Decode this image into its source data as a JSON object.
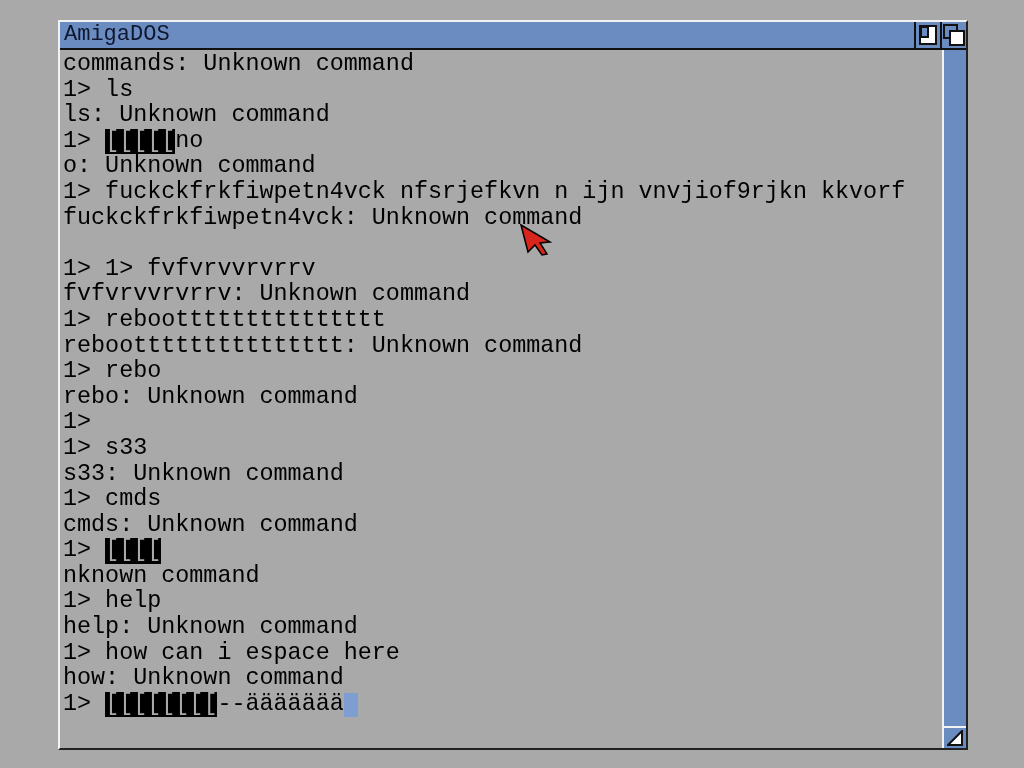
{
  "window": {
    "title": "AmigaDOS"
  },
  "lines": [
    {
      "segments": [
        {
          "text": "commands: Unknown command",
          "inverse": false
        }
      ]
    },
    {
      "segments": [
        {
          "text": "1> ls",
          "inverse": false
        }
      ]
    },
    {
      "segments": [
        {
          "text": "ls: Unknown command",
          "inverse": false
        }
      ]
    },
    {
      "segments": [
        {
          "text": "1> ",
          "inverse": false
        },
        {
          "text": "[[[[[",
          "inverse": true
        },
        {
          "text": "no",
          "inverse": false
        }
      ]
    },
    {
      "segments": [
        {
          "text": "o: Unknown command",
          "inverse": false
        }
      ]
    },
    {
      "segments": [
        {
          "text": "1> fuckckfrkfiwpetn4vck nfsrjefkvn n ijn vnvjiof9rjkn kkvorf",
          "inverse": false
        }
      ]
    },
    {
      "segments": [
        {
          "text": "fuckckfrkfiwpetn4vck: Unknown command",
          "inverse": false
        }
      ]
    },
    {
      "blank": true
    },
    {
      "segments": [
        {
          "text": "1> 1> fvfvrvvrvrrv",
          "inverse": false
        }
      ]
    },
    {
      "segments": [
        {
          "text": "fvfvrvvrvrrv: Unknown command",
          "inverse": false
        }
      ]
    },
    {
      "segments": [
        {
          "text": "1> reboottttttttttttttt",
          "inverse": false
        }
      ]
    },
    {
      "segments": [
        {
          "text": "reboottttttttttttttt: Unknown command",
          "inverse": false
        }
      ]
    },
    {
      "segments": [
        {
          "text": "1> rebo",
          "inverse": false
        }
      ]
    },
    {
      "segments": [
        {
          "text": "rebo: Unknown command",
          "inverse": false
        }
      ]
    },
    {
      "segments": [
        {
          "text": "1>",
          "inverse": false
        }
      ]
    },
    {
      "segments": [
        {
          "text": "1> s33",
          "inverse": false
        }
      ]
    },
    {
      "segments": [
        {
          "text": "s33: Unknown command",
          "inverse": false
        }
      ]
    },
    {
      "segments": [
        {
          "text": "1> cmds",
          "inverse": false
        }
      ]
    },
    {
      "segments": [
        {
          "text": "cmds: Unknown command",
          "inverse": false
        }
      ]
    },
    {
      "segments": [
        {
          "text": "1> ",
          "inverse": false
        },
        {
          "text": "[[[[",
          "inverse": true
        }
      ]
    },
    {
      "segments": [
        {
          "text": "nknown command",
          "inverse": false
        }
      ]
    },
    {
      "segments": [
        {
          "text": "1> help",
          "inverse": false
        }
      ]
    },
    {
      "segments": [
        {
          "text": "help: Unknown command",
          "inverse": false
        }
      ]
    },
    {
      "segments": [
        {
          "text": "1> how can i espace here",
          "inverse": false
        }
      ]
    },
    {
      "segments": [
        {
          "text": "how: Unknown command",
          "inverse": false
        }
      ]
    },
    {
      "segments": [
        {
          "text": "1> ",
          "inverse": false
        },
        {
          "text": "[[[[[[[[",
          "inverse": true
        },
        {
          "text": "--äääääää",
          "inverse": false
        }
      ],
      "cursor": true
    }
  ]
}
